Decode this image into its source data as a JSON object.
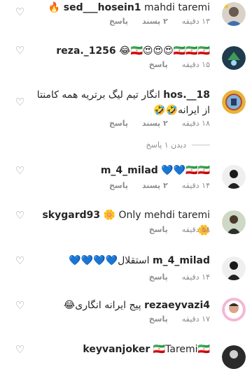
{
  "comments": [
    {
      "username": "sed___hosein1",
      "text": "mahdi taremi 🔥",
      "time": "۱۳ دقیقه",
      "likes": "۲ پسند",
      "reply": "پاسخ"
    },
    {
      "username": "reza._1256",
      "text": "😂🇮🇷😍😍😍🇮🇷🇮🇷🇮🇷",
      "time": "۱۵ دقیقه",
      "likes": "",
      "reply": "پاسخ"
    },
    {
      "username": "hos.__18",
      "text": "انگار تیم لیگ برتریه همه کامنتا از ایرانه🤣🤣",
      "time": "۱۸ دقیقه",
      "likes": "۲ پسند",
      "reply": "پاسخ"
    },
    {
      "username": "m_4_milad",
      "text": "💙💙🇮🇷🇮🇷",
      "time": "۱۴ دقیقه",
      "likes": "۲ پسند",
      "reply": "پاسخ"
    },
    {
      "username": "skygard93",
      "text": "🌼 Only mehdi taremi 🌼",
      "time": "۱۸ دقیقه",
      "likes": "",
      "reply": "پاسخ"
    },
    {
      "username": "m_4_milad",
      "text": "استقلال💙💙💙💙",
      "time": "۱۴ دقیقه",
      "likes": "",
      "reply": "پاسخ"
    },
    {
      "username": "rezaeyvazi4",
      "text": "پیج ایرانه انگاری😂",
      "time": "۱۷ دقیقه",
      "likes": "",
      "reply": "پاسخ"
    },
    {
      "username": "keyvanjoker",
      "text": "🇮🇷Taremi🇮🇷",
      "time": "",
      "likes": "",
      "reply": ""
    }
  ],
  "view_replies": "دیدن ۱ پاسخ",
  "icons": {
    "like": "heart-outline-icon"
  },
  "colors": {
    "text": "#262626",
    "secondary": "#8e8e8e",
    "divider": "#c7c7c7"
  }
}
